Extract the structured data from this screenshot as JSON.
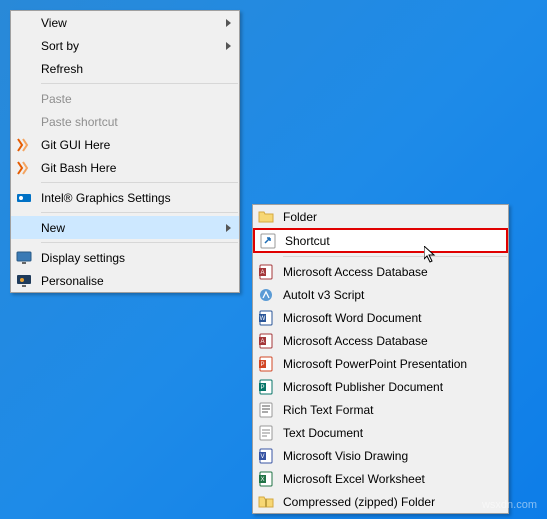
{
  "watermark": "wsxdn.com",
  "primary_menu": {
    "groups": [
      [
        {
          "label": "View",
          "submenu": true,
          "icon": null
        },
        {
          "label": "Sort by",
          "submenu": true,
          "icon": null
        },
        {
          "label": "Refresh",
          "submenu": false,
          "icon": null
        }
      ],
      [
        {
          "label": "Paste",
          "submenu": false,
          "disabled": true,
          "icon": null
        },
        {
          "label": "Paste shortcut",
          "submenu": false,
          "disabled": true,
          "icon": null
        },
        {
          "label": "Git GUI Here",
          "submenu": false,
          "icon": "git-orange"
        },
        {
          "label": "Git Bash Here",
          "submenu": false,
          "icon": "git-orange"
        }
      ],
      [
        {
          "label": "Intel® Graphics Settings",
          "submenu": false,
          "icon": "intel"
        }
      ],
      [
        {
          "label": "New",
          "submenu": true,
          "selected": true,
          "icon": null
        }
      ],
      [
        {
          "label": "Display settings",
          "submenu": false,
          "icon": "display"
        },
        {
          "label": "Personalise",
          "submenu": false,
          "icon": "personalise"
        }
      ]
    ]
  },
  "secondary_menu": {
    "items": [
      {
        "label": "Folder",
        "icon": "folder"
      },
      {
        "label": "Shortcut",
        "icon": "shortcut",
        "highlighted": true
      },
      {
        "label": "Microsoft Access Database",
        "icon": "access"
      },
      {
        "label": "AutoIt v3 Script",
        "icon": "autoit"
      },
      {
        "label": "Microsoft Word Document",
        "icon": "word"
      },
      {
        "label": "Microsoft Access Database",
        "icon": "access"
      },
      {
        "label": "Microsoft PowerPoint Presentation",
        "icon": "powerpoint"
      },
      {
        "label": "Microsoft Publisher Document",
        "icon": "publisher"
      },
      {
        "label": "Rich Text Format",
        "icon": "rtf"
      },
      {
        "label": "Text Document",
        "icon": "text"
      },
      {
        "label": "Microsoft Visio Drawing",
        "icon": "visio"
      },
      {
        "label": "Microsoft Excel Worksheet",
        "icon": "excel"
      },
      {
        "label": "Compressed (zipped) Folder",
        "icon": "zip"
      }
    ]
  }
}
